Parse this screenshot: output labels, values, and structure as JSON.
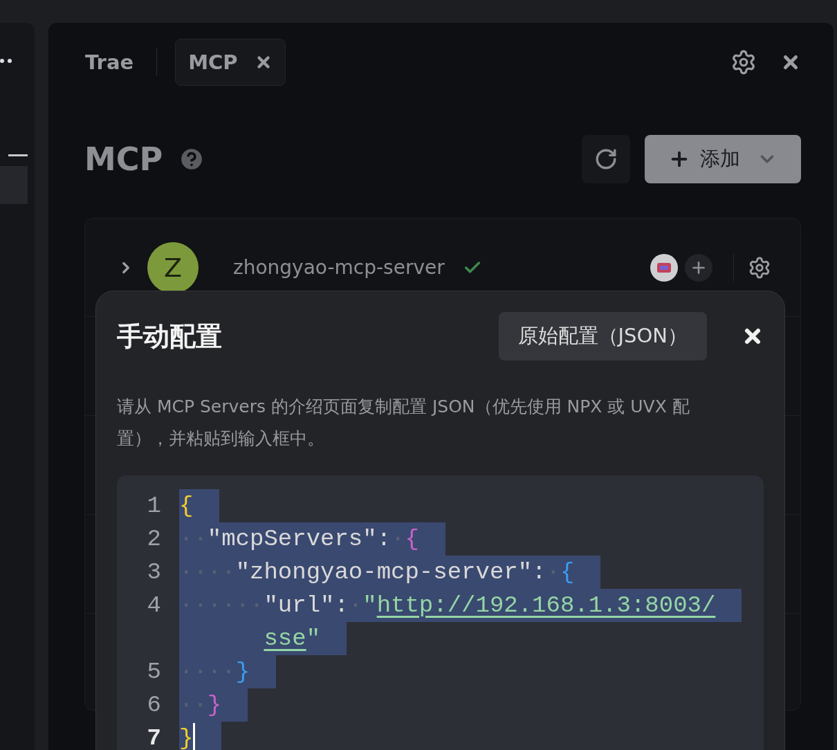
{
  "tabs": [
    {
      "label": "Trae",
      "selected": false,
      "closable": false
    },
    {
      "label": "MCP",
      "selected": true,
      "closable": true
    }
  ],
  "heading": {
    "title": "MCP",
    "add_button": "添加"
  },
  "servers": [
    {
      "initial": "Z",
      "name": "zhongyao-mcp-server",
      "connected": true,
      "expanded": false
    }
  ],
  "dialog": {
    "title": "手动配置",
    "mode_button": "原始配置（JSON）",
    "description": "请从 MCP Servers 的介绍页面复制配置 JSON（优先使用 NPX 或 UVX 配置），并粘贴到输入框中。",
    "code_lines": [
      {
        "number": "1",
        "selected": true,
        "current": false,
        "tokens": [
          {
            "kind": "brace1",
            "text": "{"
          }
        ]
      },
      {
        "number": "2",
        "selected": true,
        "current": false,
        "tokens": [
          {
            "kind": "ws",
            "text": "··"
          },
          {
            "kind": "plain",
            "text": "\"mcpServers\":"
          },
          {
            "kind": "ws",
            "text": "·"
          },
          {
            "kind": "brace2",
            "text": "{"
          }
        ]
      },
      {
        "number": "3",
        "selected": true,
        "current": false,
        "tokens": [
          {
            "kind": "ws",
            "text": "····"
          },
          {
            "kind": "plain",
            "text": "\"zhongyao-mcp-server\":"
          },
          {
            "kind": "ws",
            "text": "·"
          },
          {
            "kind": "brace3",
            "text": "{"
          }
        ]
      },
      {
        "number": "4",
        "selected": true,
        "current": false,
        "tokens": [
          {
            "kind": "ws",
            "text": "······"
          },
          {
            "kind": "plain",
            "text": "\"url\":"
          },
          {
            "kind": "ws",
            "text": "·"
          },
          {
            "kind": "string",
            "text": "\""
          },
          {
            "kind": "link",
            "text": "http://192.168.1.3:8003/"
          }
        ],
        "wrap": [
          {
            "kind": "link",
            "text": "sse"
          },
          {
            "kind": "string",
            "text": "\""
          }
        ]
      },
      {
        "number": "5",
        "selected": true,
        "current": false,
        "tokens": [
          {
            "kind": "ws",
            "text": "····"
          },
          {
            "kind": "brace3",
            "text": "}"
          }
        ]
      },
      {
        "number": "6",
        "selected": true,
        "current": false,
        "tokens": [
          {
            "kind": "ws",
            "text": "··"
          },
          {
            "kind": "brace2",
            "text": "}"
          }
        ]
      },
      {
        "number": "7",
        "selected": true,
        "current": true,
        "tokens": [
          {
            "kind": "brace1",
            "text": "}"
          }
        ]
      }
    ]
  }
}
